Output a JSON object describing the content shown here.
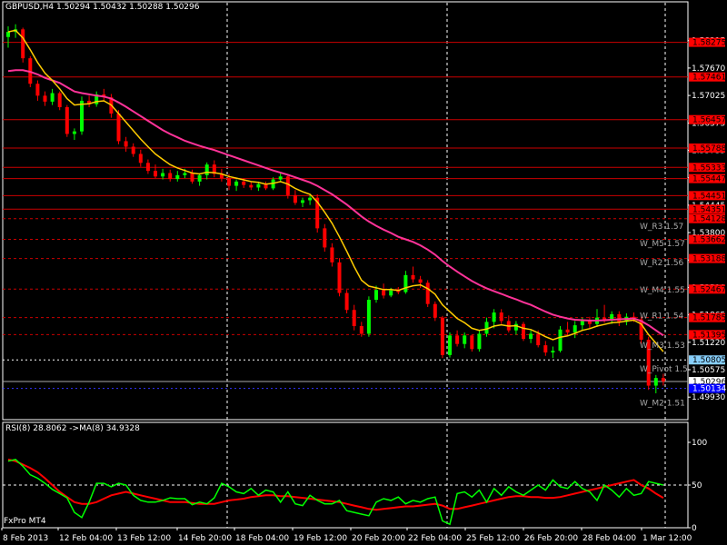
{
  "header": {
    "price_title": "GBPUSD,H4  1.50294 1.50432 1.50288 1.50296",
    "rsi_title": "RSI(8) 28.8062  ->MA(8) 34.9328",
    "broker": "FxPro MT4"
  },
  "colors": {
    "background": "#000000",
    "bull": "#00ff00",
    "bear": "#ff0000",
    "ma_fast": "#ffcc00",
    "ma_slow": "#ff3399",
    "level_line": "#cc0000",
    "level_label_bg": "#ff0000",
    "pivot_bg": "#87cefa",
    "bid_bg": "#ffffff",
    "m2_bg": "#0000ff",
    "rsi": "#00ff00",
    "rsi_ma": "#ff0000"
  },
  "chart_data": [
    {
      "type": "candlestick",
      "symbol": "GBPUSD",
      "timeframe": "H4",
      "ylim": [
        1.494,
        1.5895
      ],
      "price_ticks": [
        "1.58315",
        "1.57670",
        "1.57025",
        "1.56375",
        "1.55735",
        "1.55090",
        "1.54445",
        "1.53800",
        "1.53155",
        "1.52510",
        "1.51865",
        "1.51220",
        "1.50575",
        "1.49930"
      ],
      "x_ticks": [
        "8 Feb 2013",
        "12 Feb 04:00",
        "13 Feb 12:00",
        "14 Feb 20:00",
        "18 Feb 04:00",
        "19 Feb 12:00",
        "20 Feb 20:00",
        "22 Feb 04:00",
        "25 Feb 12:00",
        "26 Feb 20:00",
        "28 Feb 04:00",
        "1 Mar 12:00"
      ],
      "candles": [
        [
          1.584,
          1.5865,
          1.5815,
          1.5852
        ],
        [
          1.5852,
          1.587,
          1.5838,
          1.5858
        ],
        [
          1.5858,
          1.5862,
          1.578,
          1.579
        ],
        [
          1.579,
          1.5795,
          1.5722,
          1.573
        ],
        [
          1.573,
          1.5738,
          1.569,
          1.5702
        ],
        [
          1.5702,
          1.5712,
          1.5678,
          1.5688
        ],
        [
          1.5688,
          1.5718,
          1.568,
          1.5708
        ],
        [
          1.5708,
          1.5712,
          1.5668,
          1.5675
        ],
        [
          1.5675,
          1.568,
          1.5605,
          1.5612
        ],
        [
          1.5612,
          1.5625,
          1.5598,
          1.5618
        ],
        [
          1.5618,
          1.57,
          1.561,
          1.569
        ],
        [
          1.569,
          1.5702,
          1.5675,
          1.5682
        ],
        [
          1.5682,
          1.5712,
          1.5676,
          1.5705
        ],
        [
          1.5705,
          1.5718,
          1.569,
          1.5698
        ],
        [
          1.5698,
          1.5706,
          1.565,
          1.566
        ],
        [
          1.566,
          1.5668,
          1.5588,
          1.5595
        ],
        [
          1.5595,
          1.5605,
          1.557,
          1.5582
        ],
        [
          1.5582,
          1.559,
          1.5558,
          1.5565
        ],
        [
          1.5565,
          1.5575,
          1.5535,
          1.5544
        ],
        [
          1.5544,
          1.5552,
          1.5518,
          1.5525
        ],
        [
          1.5525,
          1.554,
          1.5508,
          1.5512
        ],
        [
          1.5512,
          1.553,
          1.5505,
          1.552
        ],
        [
          1.552,
          1.5528,
          1.55,
          1.5506
        ],
        [
          1.5506,
          1.5525,
          1.55,
          1.5515
        ],
        [
          1.5515,
          1.553,
          1.5508,
          1.552
        ],
        [
          1.552,
          1.5528,
          1.5495,
          1.55
        ],
        [
          1.55,
          1.552,
          1.549,
          1.5515
        ],
        [
          1.5515,
          1.5545,
          1.5505,
          1.554
        ],
        [
          1.554,
          1.555,
          1.551,
          1.5518
        ],
        [
          1.5518,
          1.553,
          1.55,
          1.5508
        ],
        [
          1.5508,
          1.5518,
          1.548,
          1.549
        ],
        [
          1.549,
          1.5505,
          1.5478,
          1.55
        ],
        [
          1.55,
          1.5508,
          1.5485,
          1.5492
        ],
        [
          1.5492,
          1.55,
          1.548,
          1.5486
        ],
        [
          1.5486,
          1.55,
          1.5478,
          1.5494
        ],
        [
          1.5494,
          1.55,
          1.548,
          1.5484
        ],
        [
          1.5484,
          1.551,
          1.548,
          1.5505
        ],
        [
          1.5505,
          1.552,
          1.5498,
          1.5512
        ],
        [
          1.5512,
          1.5518,
          1.546,
          1.5468
        ],
        [
          1.5468,
          1.548,
          1.5445,
          1.545
        ],
        [
          1.545,
          1.5462,
          1.544,
          1.5456
        ],
        [
          1.5456,
          1.547,
          1.5445,
          1.5462
        ],
        [
          1.5462,
          1.547,
          1.538,
          1.539
        ],
        [
          1.539,
          1.54,
          1.5335,
          1.5345
        ],
        [
          1.5345,
          1.5355,
          1.53,
          1.531
        ],
        [
          1.531,
          1.532,
          1.523,
          1.5238
        ],
        [
          1.5238,
          1.5245,
          1.519,
          1.5198
        ],
        [
          1.5198,
          1.521,
          1.515,
          1.516
        ],
        [
          1.516,
          1.517,
          1.5135,
          1.5142
        ],
        [
          1.5142,
          1.523,
          1.5135,
          1.5222
        ],
        [
          1.5222,
          1.5255,
          1.5215,
          1.5245
        ],
        [
          1.5245,
          1.526,
          1.5225,
          1.5232
        ],
        [
          1.5232,
          1.525,
          1.5228,
          1.5244
        ],
        [
          1.5244,
          1.5252,
          1.5235,
          1.524
        ],
        [
          1.524,
          1.529,
          1.5236,
          1.528
        ],
        [
          1.528,
          1.53,
          1.5262,
          1.527
        ],
        [
          1.527,
          1.5278,
          1.525,
          1.5262
        ],
        [
          1.5262,
          1.5268,
          1.5205,
          1.5212
        ],
        [
          1.5212,
          1.5218,
          1.5172,
          1.518
        ],
        [
          1.518,
          1.5184,
          1.5085,
          1.5092
        ],
        [
          1.5092,
          1.5145,
          1.5086,
          1.5138
        ],
        [
          1.5138,
          1.515,
          1.5112,
          1.5118
        ],
        [
          1.5118,
          1.5145,
          1.5108,
          1.5138
        ],
        [
          1.5138,
          1.514,
          1.51,
          1.5106
        ],
        [
          1.5106,
          1.515,
          1.51,
          1.5142
        ],
        [
          1.5142,
          1.518,
          1.5135,
          1.517
        ],
        [
          1.517,
          1.52,
          1.5155,
          1.5192
        ],
        [
          1.5192,
          1.52,
          1.5165,
          1.5172
        ],
        [
          1.5172,
          1.5185,
          1.5145,
          1.515
        ],
        [
          1.515,
          1.5172,
          1.514,
          1.5165
        ],
        [
          1.5165,
          1.517,
          1.5125,
          1.513
        ],
        [
          1.513,
          1.515,
          1.512,
          1.5142
        ],
        [
          1.5142,
          1.515,
          1.511,
          1.5115
        ],
        [
          1.5115,
          1.5125,
          1.509,
          1.5098
        ],
        [
          1.5098,
          1.5112,
          1.5085,
          1.5102
        ],
        [
          1.5102,
          1.516,
          1.5098,
          1.5152
        ],
        [
          1.5152,
          1.517,
          1.5138,
          1.5145
        ],
        [
          1.5145,
          1.5172,
          1.5132,
          1.5162
        ],
        [
          1.5162,
          1.518,
          1.515,
          1.5172
        ],
        [
          1.5172,
          1.5182,
          1.5155,
          1.5165
        ],
        [
          1.5165,
          1.52,
          1.5158,
          1.518
        ],
        [
          1.518,
          1.521,
          1.5168,
          1.5175
        ],
        [
          1.5175,
          1.5195,
          1.5165,
          1.5188
        ],
        [
          1.5188,
          1.5195,
          1.516,
          1.517
        ],
        [
          1.517,
          1.519,
          1.5162,
          1.5182
        ],
        [
          1.5182,
          1.5192,
          1.517,
          1.5176
        ],
        [
          1.5176,
          1.5182,
          1.5118,
          1.5128
        ],
        [
          1.5128,
          1.5135,
          1.501,
          1.502
        ],
        [
          1.502,
          1.5045,
          1.5002,
          1.5038
        ],
        [
          1.5038,
          1.5048,
          1.502,
          1.503
        ]
      ],
      "ma_fast": [
        1.5852,
        1.5856,
        1.5838,
        1.581,
        1.578,
        1.5755,
        1.5738,
        1.5718,
        1.5695,
        1.568,
        1.5682,
        1.5683,
        1.5688,
        1.569,
        1.568,
        1.566,
        1.564,
        1.562,
        1.56,
        1.5582,
        1.5565,
        1.5552,
        1.554,
        1.5532,
        1.5526,
        1.552,
        1.5518,
        1.5522,
        1.5521,
        1.5518,
        1.5512,
        1.5508,
        1.5504,
        1.55,
        1.5498,
        1.5494,
        1.5496,
        1.55,
        1.5494,
        1.5484,
        1.5476,
        1.547,
        1.5452,
        1.5428,
        1.5402,
        1.537,
        1.5336,
        1.53,
        1.5268,
        1.5254,
        1.525,
        1.5246,
        1.5246,
        1.5244,
        1.525,
        1.5255,
        1.5257,
        1.5248,
        1.5235,
        1.521,
        1.5194,
        1.5178,
        1.5168,
        1.5155,
        1.515,
        1.5153,
        1.516,
        1.5163,
        1.516,
        1.5161,
        1.5155,
        1.5152,
        1.5144,
        1.5135,
        1.5128,
        1.5134,
        1.5137,
        1.5143,
        1.515,
        1.5154,
        1.516,
        1.5164,
        1.5168,
        1.5169,
        1.5172,
        1.5174,
        1.5165,
        1.514,
        1.512,
        1.51
      ],
      "ma_slow": [
        1.576,
        1.5762,
        1.5762,
        1.5758,
        1.5752,
        1.5744,
        1.5738,
        1.5732,
        1.5722,
        1.5712,
        1.5708,
        1.5705,
        1.5702,
        1.57,
        1.5695,
        1.5686,
        1.5676,
        1.5665,
        1.5654,
        1.5643,
        1.5632,
        1.5621,
        1.5612,
        1.5604,
        1.5596,
        1.559,
        1.5584,
        1.5579,
        1.5574,
        1.5568,
        1.5562,
        1.5556,
        1.555,
        1.5544,
        1.5538,
        1.5532,
        1.5526,
        1.5521,
        1.5516,
        1.551,
        1.5504,
        1.5498,
        1.549,
        1.548,
        1.547,
        1.5458,
        1.5446,
        1.5432,
        1.5418,
        1.5406,
        1.5396,
        1.5387,
        1.5379,
        1.537,
        1.5364,
        1.5358,
        1.535,
        1.534,
        1.5328,
        1.5313,
        1.53,
        1.5288,
        1.5277,
        1.5266,
        1.5257,
        1.5249,
        1.5242,
        1.5236,
        1.5229,
        1.5223,
        1.5216,
        1.521,
        1.5202,
        1.5194,
        1.5187,
        1.5182,
        1.5178,
        1.5175,
        1.5174,
        1.5173,
        1.5173,
        1.5174,
        1.5175,
        1.5176,
        1.5177,
        1.5178,
        1.5172,
        1.5162,
        1.515,
        1.5138
      ],
      "levels": [
        {
          "label": "1.58275",
          "price": 1.58275,
          "style": "solid"
        },
        {
          "label": "1.57461",
          "price": 1.57461,
          "style": "solid"
        },
        {
          "label": "1.56457",
          "price": 1.56457,
          "style": "solid"
        },
        {
          "label": "1.55788",
          "price": 1.55788,
          "style": "solid"
        },
        {
          "label": "1.55333",
          "price": 1.55333,
          "style": "solid"
        },
        {
          "label": "1.55447",
          "price": 1.5507,
          "style": "solid"
        },
        {
          "label": "1.54451",
          "price": 1.5467,
          "style": "solid"
        },
        {
          "label": "1.54351",
          "price": 1.54351,
          "style": "solid"
        },
        {
          "label": "1.54128",
          "price": 1.54128,
          "style": "dotted"
        },
        {
          "label": "1.53662",
          "price": 1.5364,
          "style": "dotted"
        },
        {
          "label": "1.53188",
          "price": 1.5319,
          "style": "dotted"
        },
        {
          "label": "1.52467",
          "price": 1.5247,
          "style": "dotted"
        },
        {
          "label": "1.51785",
          "price": 1.518,
          "style": "dotted"
        },
        {
          "label": "1.51395",
          "price": 1.514,
          "style": "dotted"
        }
      ],
      "special_levels": [
        {
          "label": "1.50805",
          "price": 1.50805,
          "kind": "pivot"
        },
        {
          "label": "1.50296",
          "price": 1.50296,
          "kind": "bid"
        },
        {
          "label": "1.50134",
          "price": 1.50134,
          "kind": "m2"
        }
      ],
      "pivot_names": [
        {
          "text": "W_R3 1.57",
          "price": 1.5395
        },
        {
          "text": "W_M5 1.57",
          "price": 1.5355
        },
        {
          "text": "W_R2 1.56",
          "price": 1.531
        },
        {
          "text": "W_M4 1.55",
          "price": 1.5245
        },
        {
          "text": "W_R1 1.54",
          "price": 1.5185
        },
        {
          "text": "W_M3 1.53",
          "price": 1.5115
        },
        {
          "text": "W_Pivot 1.5",
          "price": 1.506
        },
        {
          "text": "W_M2 1.51",
          "price": 1.498
        }
      ]
    },
    {
      "type": "line",
      "title": "RSI(8) 28.8062  ->MA(8) 34.9328",
      "ylim": [
        0,
        100
      ],
      "y_ticks": [
        "100",
        "50",
        "0"
      ],
      "series": [
        {
          "name": "RSI(8)",
          "values": [
            78,
            80,
            72,
            62,
            58,
            52,
            45,
            40,
            35,
            18,
            12,
            30,
            52,
            52,
            48,
            52,
            50,
            38,
            32,
            30,
            30,
            32,
            35,
            34,
            34,
            27,
            30,
            28,
            35,
            52,
            48,
            42,
            40,
            46,
            38,
            44,
            42,
            30,
            42,
            28,
            26,
            38,
            32,
            28,
            28,
            32,
            20,
            18,
            16,
            14,
            30,
            34,
            32,
            36,
            28,
            32,
            30,
            34,
            36,
            8,
            4,
            40,
            42,
            36,
            44,
            30,
            46,
            38,
            48,
            42,
            38,
            44,
            50,
            44,
            56,
            48,
            46,
            54,
            46,
            42,
            32,
            50,
            44,
            36,
            46,
            38,
            40,
            54,
            52,
            50
          ]
        },
        {
          "name": "MA(8)",
          "values": [
            80,
            78,
            74,
            70,
            65,
            58,
            50,
            42,
            36,
            30,
            28,
            28,
            30,
            34,
            38,
            40,
            42,
            40,
            38,
            36,
            34,
            32,
            30,
            30,
            30,
            29,
            28,
            28,
            28,
            30,
            32,
            33,
            34,
            36,
            37,
            38,
            38,
            37,
            37,
            36,
            35,
            34,
            33,
            32,
            31,
            30,
            28,
            26,
            24,
            22,
            21,
            22,
            23,
            24,
            25,
            25,
            26,
            27,
            28,
            26,
            22,
            22,
            24,
            26,
            28,
            30,
            32,
            34,
            36,
            37,
            37,
            36,
            36,
            35,
            35,
            36,
            38,
            40,
            42,
            44,
            46,
            48,
            50,
            52,
            54,
            56,
            50,
            46,
            40,
            35
          ]
        }
      ]
    }
  ]
}
